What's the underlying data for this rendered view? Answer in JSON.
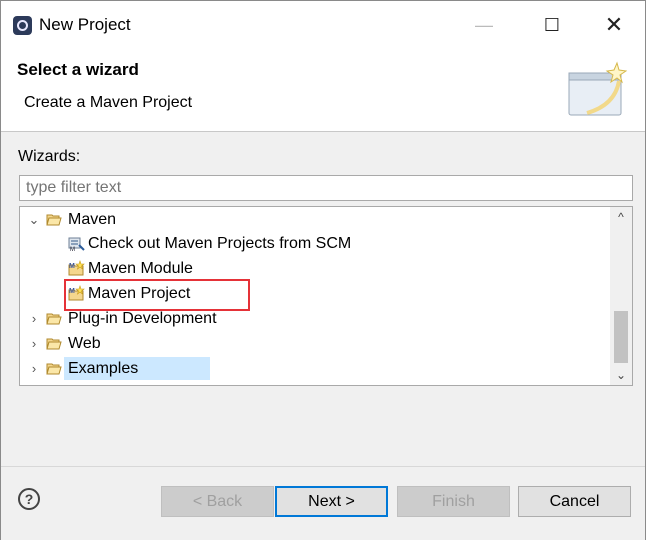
{
  "window": {
    "title": "New Project",
    "controls": {
      "minimize": "—",
      "maximize": "☐",
      "close": "✕"
    }
  },
  "header": {
    "title": "Select a wizard",
    "description": "Create a Maven Project"
  },
  "wizards": {
    "label": "Wizards:",
    "filter_placeholder": "type filter text",
    "tree": [
      {
        "label": "Maven",
        "expanded": true,
        "icon": "folder-open-icon"
      },
      {
        "label": "Check out Maven Projects from SCM",
        "icon": "scm-checkout-icon"
      },
      {
        "label": "Maven Module",
        "icon": "maven-module-icon"
      },
      {
        "label": "Maven Project",
        "icon": "maven-project-icon",
        "selected": true
      },
      {
        "label": "Plug-in Development",
        "expanded": false,
        "icon": "folder-icon"
      },
      {
        "label": "Web",
        "expanded": false,
        "icon": "folder-icon"
      },
      {
        "label": "Examples",
        "expanded": false,
        "icon": "folder-icon"
      }
    ]
  },
  "footer": {
    "help": "?",
    "back": "< Back",
    "next": "Next >",
    "finish": "Finish",
    "cancel": "Cancel"
  },
  "colors": {
    "selection": "#cce8ff",
    "highlight": "#e53238",
    "default_button_border": "#0078d7"
  }
}
